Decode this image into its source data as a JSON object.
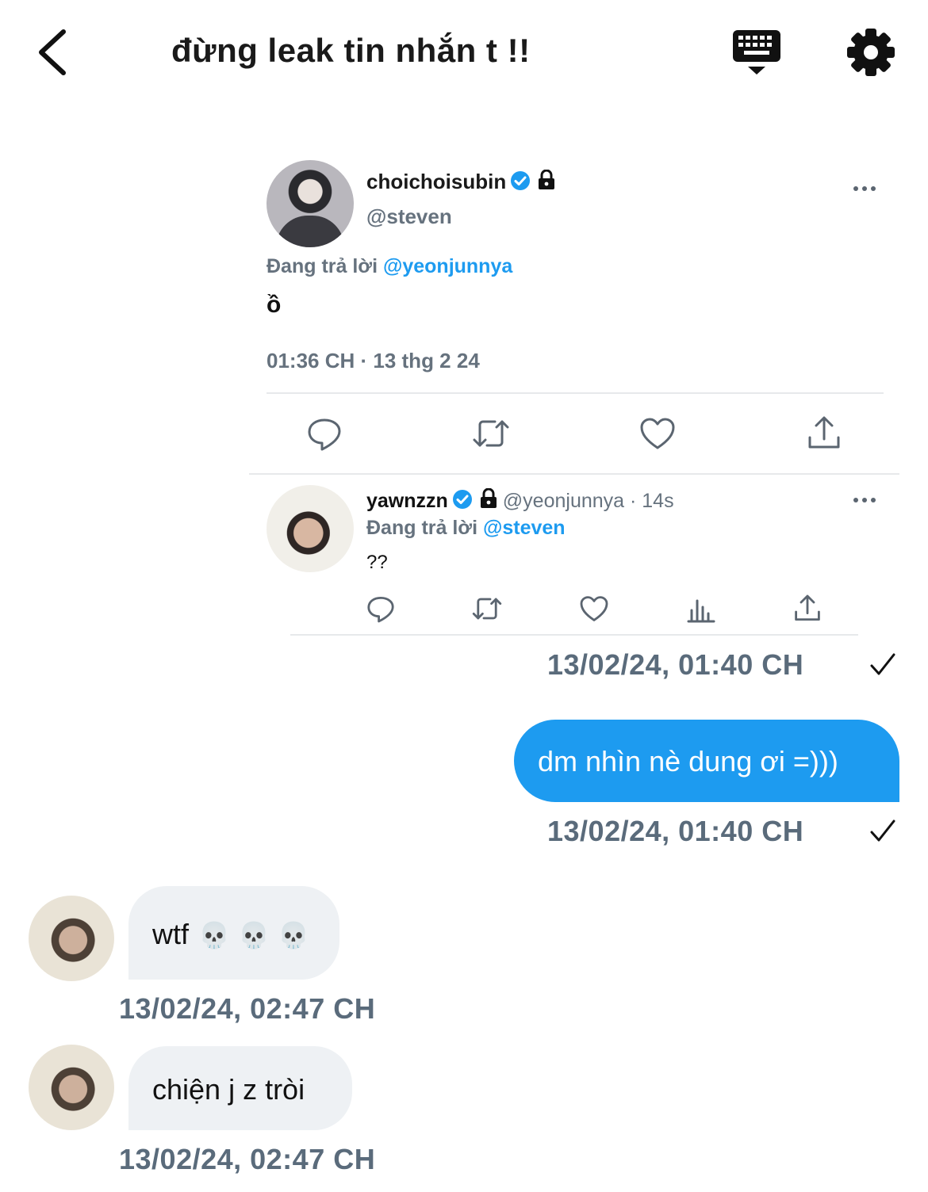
{
  "header": {
    "title": "đừng leak tin nhắn t !!"
  },
  "tweet": {
    "author_name": "choichoisubin",
    "author_handle": "@steven",
    "reply_prefix": "Đang trả lời",
    "reply_mention": "@yeonjunnya",
    "text": "ồ",
    "time": "01:36 CH · 13 thg 2 24"
  },
  "reply": {
    "author_name": "yawnzzn",
    "author_meta": "@yeonjunnya · 14s",
    "reply_prefix": "Đang trả lời",
    "reply_mention": "@steven",
    "text": "??"
  },
  "messages": {
    "card_stamp": "13/02/24, 01:40 CH",
    "out_text": "dm nhìn nè dung ơi =)))",
    "out_stamp": "13/02/24, 01:40 CH",
    "in1_text": "wtf",
    "in1_emoji": "💀 💀 💀",
    "in1_stamp": "13/02/24, 02:47 CH",
    "in2_text": "chiện j z tròi",
    "in2_stamp": "13/02/24, 02:47 CH"
  },
  "colors": {
    "accent": "#1d9bf0",
    "muted": "#66727e",
    "bubble_in": "#eef1f4"
  },
  "icons": [
    "back-icon",
    "keyboard-icon",
    "gear-icon",
    "verified-icon",
    "lock-icon",
    "more-icon",
    "reply-icon",
    "retweet-icon",
    "like-icon",
    "share-icon",
    "analytics-icon",
    "check-icon",
    "skull-emoji"
  ]
}
